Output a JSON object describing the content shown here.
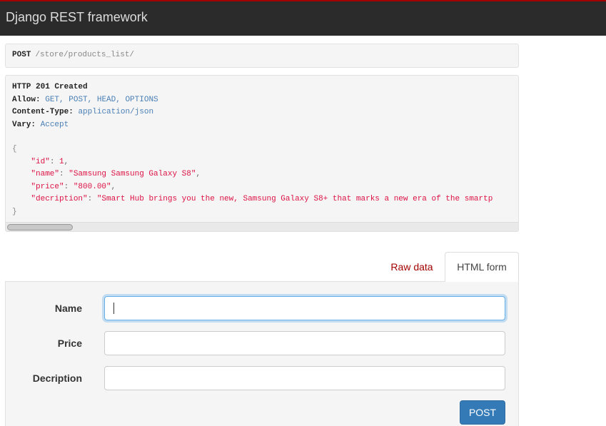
{
  "app": {
    "title": "Django REST framework"
  },
  "request": {
    "method": "POST",
    "path": "/store/products_list/"
  },
  "response": {
    "status": "HTTP 201 Created",
    "headers": [
      {
        "name": "Allow",
        "value": "GET, POST, HEAD, OPTIONS"
      },
      {
        "name": "Content-Type",
        "value": "application/json"
      },
      {
        "name": "Vary",
        "value": "Accept"
      }
    ],
    "body": {
      "open": "{",
      "close": "}",
      "fields": [
        {
          "key": "\"id\"",
          "value": "1"
        },
        {
          "key": "\"name\"",
          "value": "\"Samsung Samsung Galaxy S8\""
        },
        {
          "key": "\"price\"",
          "value": "\"800.00\""
        },
        {
          "key": "\"decription\"",
          "value": "\"Smart Hub brings you the new, Samsung Galaxy S8+ that marks a new era of the smartp"
        }
      ]
    }
  },
  "tabs": {
    "raw": "Raw data",
    "html": "HTML form"
  },
  "form": {
    "fields": [
      {
        "label": "Name",
        "value": ""
      },
      {
        "label": "Price",
        "value": ""
      },
      {
        "label": "Decription",
        "value": ""
      }
    ],
    "submit": "POST"
  },
  "colors": {
    "navbar": "#2b2b2b",
    "accent": "#a30000",
    "button": "#337ab7",
    "focus": "#66afe9"
  }
}
